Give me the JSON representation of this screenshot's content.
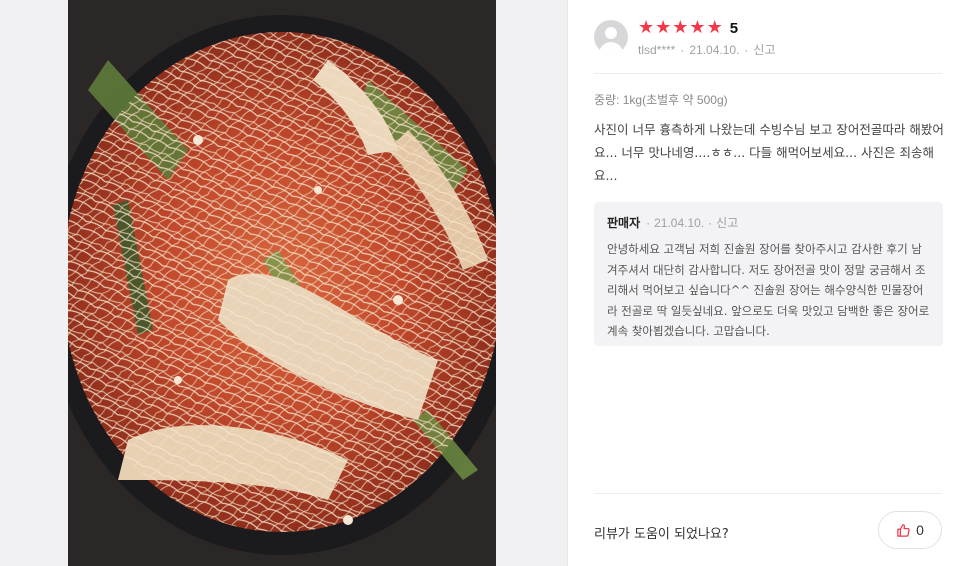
{
  "review": {
    "photo_alt": "review-photo",
    "rating_stars": 5,
    "rating_label": "5",
    "user_id": "tlsd****",
    "date": "21.04.10.",
    "report_label": "신고",
    "weight": "중량: 1kg(초벌후 약 500g)",
    "text": "사진이 너무 흉측하게 나왔는데 수빙수님 보고 장어전골따라 해봤어요... 너무 맛나네영....ㅎㅎ... 다들 해먹어보세요... 사진은 죄송해요..."
  },
  "reply": {
    "author": "판매자",
    "date": "21.04.10.",
    "report_label": "신고",
    "text": "안녕하세요 고객님 저희 진솔원 장어를 찾아주시고 감사한 후기 남겨주셔서 대단히 감사합니다. 저도 장어전골 맛이 정말 궁금해서 조리해서 먹어보고 싶습니다^^ 진솔원 장어는 해수양식한 민물장어라 전골로 딱 일듯싶네요. 앞으로도 더욱 맛있고 담백한 좋은 장어로 계속 찾아뵙겠습니다. 고맙습니다."
  },
  "helpful": {
    "label": "리뷰가 도움이 되었나요?",
    "count": "0"
  },
  "colors": {
    "star": "#f4384b",
    "like_icon": "#f4384b"
  }
}
